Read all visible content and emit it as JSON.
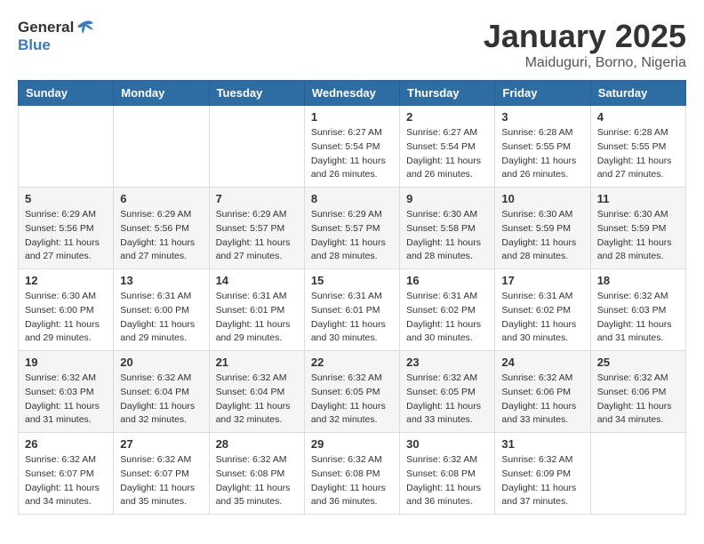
{
  "logo": {
    "general": "General",
    "blue": "Blue"
  },
  "title": "January 2025",
  "location": "Maiduguri, Borno, Nigeria",
  "weekdays": [
    "Sunday",
    "Monday",
    "Tuesday",
    "Wednesday",
    "Thursday",
    "Friday",
    "Saturday"
  ],
  "weeks": [
    [
      {
        "day": "",
        "info": ""
      },
      {
        "day": "",
        "info": ""
      },
      {
        "day": "",
        "info": ""
      },
      {
        "day": "1",
        "info": "Sunrise: 6:27 AM\nSunset: 5:54 PM\nDaylight: 11 hours and 26 minutes."
      },
      {
        "day": "2",
        "info": "Sunrise: 6:27 AM\nSunset: 5:54 PM\nDaylight: 11 hours and 26 minutes."
      },
      {
        "day": "3",
        "info": "Sunrise: 6:28 AM\nSunset: 5:55 PM\nDaylight: 11 hours and 26 minutes."
      },
      {
        "day": "4",
        "info": "Sunrise: 6:28 AM\nSunset: 5:55 PM\nDaylight: 11 hours and 27 minutes."
      }
    ],
    [
      {
        "day": "5",
        "info": "Sunrise: 6:29 AM\nSunset: 5:56 PM\nDaylight: 11 hours and 27 minutes."
      },
      {
        "day": "6",
        "info": "Sunrise: 6:29 AM\nSunset: 5:56 PM\nDaylight: 11 hours and 27 minutes."
      },
      {
        "day": "7",
        "info": "Sunrise: 6:29 AM\nSunset: 5:57 PM\nDaylight: 11 hours and 27 minutes."
      },
      {
        "day": "8",
        "info": "Sunrise: 6:29 AM\nSunset: 5:57 PM\nDaylight: 11 hours and 28 minutes."
      },
      {
        "day": "9",
        "info": "Sunrise: 6:30 AM\nSunset: 5:58 PM\nDaylight: 11 hours and 28 minutes."
      },
      {
        "day": "10",
        "info": "Sunrise: 6:30 AM\nSunset: 5:59 PM\nDaylight: 11 hours and 28 minutes."
      },
      {
        "day": "11",
        "info": "Sunrise: 6:30 AM\nSunset: 5:59 PM\nDaylight: 11 hours and 28 minutes."
      }
    ],
    [
      {
        "day": "12",
        "info": "Sunrise: 6:30 AM\nSunset: 6:00 PM\nDaylight: 11 hours and 29 minutes."
      },
      {
        "day": "13",
        "info": "Sunrise: 6:31 AM\nSunset: 6:00 PM\nDaylight: 11 hours and 29 minutes."
      },
      {
        "day": "14",
        "info": "Sunrise: 6:31 AM\nSunset: 6:01 PM\nDaylight: 11 hours and 29 minutes."
      },
      {
        "day": "15",
        "info": "Sunrise: 6:31 AM\nSunset: 6:01 PM\nDaylight: 11 hours and 30 minutes."
      },
      {
        "day": "16",
        "info": "Sunrise: 6:31 AM\nSunset: 6:02 PM\nDaylight: 11 hours and 30 minutes."
      },
      {
        "day": "17",
        "info": "Sunrise: 6:31 AM\nSunset: 6:02 PM\nDaylight: 11 hours and 30 minutes."
      },
      {
        "day": "18",
        "info": "Sunrise: 6:32 AM\nSunset: 6:03 PM\nDaylight: 11 hours and 31 minutes."
      }
    ],
    [
      {
        "day": "19",
        "info": "Sunrise: 6:32 AM\nSunset: 6:03 PM\nDaylight: 11 hours and 31 minutes."
      },
      {
        "day": "20",
        "info": "Sunrise: 6:32 AM\nSunset: 6:04 PM\nDaylight: 11 hours and 32 minutes."
      },
      {
        "day": "21",
        "info": "Sunrise: 6:32 AM\nSunset: 6:04 PM\nDaylight: 11 hours and 32 minutes."
      },
      {
        "day": "22",
        "info": "Sunrise: 6:32 AM\nSunset: 6:05 PM\nDaylight: 11 hours and 32 minutes."
      },
      {
        "day": "23",
        "info": "Sunrise: 6:32 AM\nSunset: 6:05 PM\nDaylight: 11 hours and 33 minutes."
      },
      {
        "day": "24",
        "info": "Sunrise: 6:32 AM\nSunset: 6:06 PM\nDaylight: 11 hours and 33 minutes."
      },
      {
        "day": "25",
        "info": "Sunrise: 6:32 AM\nSunset: 6:06 PM\nDaylight: 11 hours and 34 minutes."
      }
    ],
    [
      {
        "day": "26",
        "info": "Sunrise: 6:32 AM\nSunset: 6:07 PM\nDaylight: 11 hours and 34 minutes."
      },
      {
        "day": "27",
        "info": "Sunrise: 6:32 AM\nSunset: 6:07 PM\nDaylight: 11 hours and 35 minutes."
      },
      {
        "day": "28",
        "info": "Sunrise: 6:32 AM\nSunset: 6:08 PM\nDaylight: 11 hours and 35 minutes."
      },
      {
        "day": "29",
        "info": "Sunrise: 6:32 AM\nSunset: 6:08 PM\nDaylight: 11 hours and 36 minutes."
      },
      {
        "day": "30",
        "info": "Sunrise: 6:32 AM\nSunset: 6:08 PM\nDaylight: 11 hours and 36 minutes."
      },
      {
        "day": "31",
        "info": "Sunrise: 6:32 AM\nSunset: 6:09 PM\nDaylight: 11 hours and 37 minutes."
      },
      {
        "day": "",
        "info": ""
      }
    ]
  ]
}
